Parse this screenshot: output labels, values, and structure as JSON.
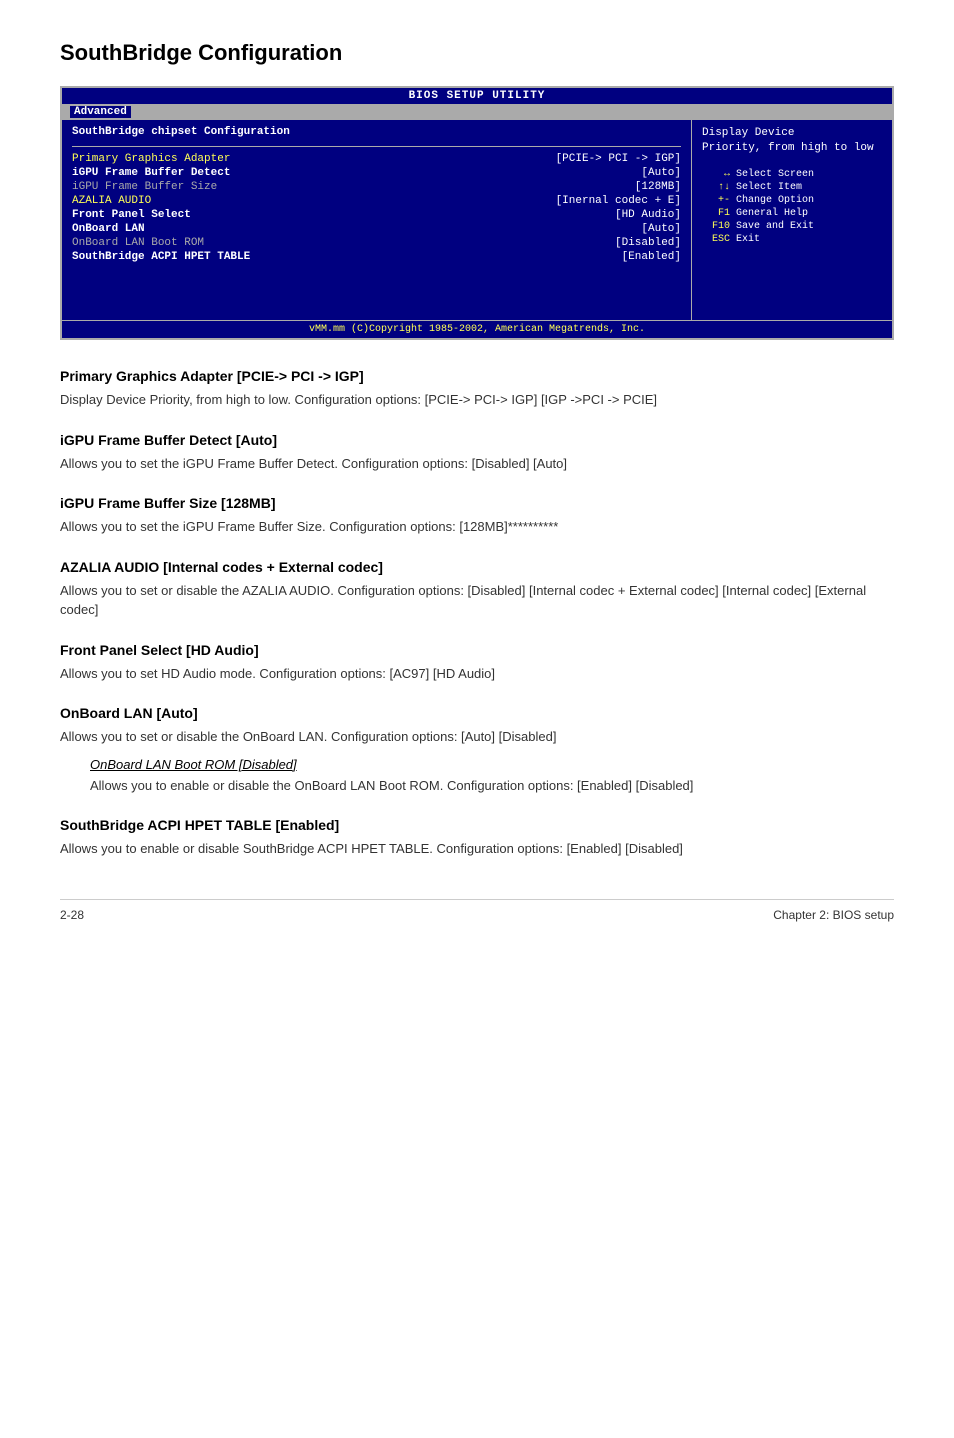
{
  "page": {
    "title": "SouthBridge Configuration",
    "footer_left": "2-28",
    "footer_right": "Chapter 2: BIOS setup"
  },
  "bios": {
    "top_bar": "BIOS SETUP UTILITY",
    "menu_active": "Advanced",
    "section_title": "SouthBridge chipset Configuration",
    "rows": [
      {
        "label": "Primary Graphics Adapter",
        "label_class": "yellow",
        "value": "[PCIE-> PCI -> IGP]"
      },
      {
        "label": "iGPU Frame Buffer Detect",
        "label_class": "highlight",
        "value": "[Auto]"
      },
      {
        "label": "iGPU Frame Buffer Size",
        "label_class": "normal",
        "value": "[128MB]"
      },
      {
        "label": "AZALIA AUDIO",
        "label_class": "yellow",
        "value": "[Inernal codec + E]"
      },
      {
        "label": "Front Panel Select",
        "label_class": "highlight",
        "value": "[HD Audio]"
      },
      {
        "label": "OnBoard LAN",
        "label_class": "highlight",
        "value": "[Auto]"
      },
      {
        "label": " OnBoard LAN Boot ROM",
        "label_class": "normal",
        "value": "[Disabled]"
      },
      {
        "label": "SouthBridge ACPI HPET TABLE",
        "label_class": "highlight",
        "value": "[Enabled]"
      }
    ],
    "help_title": "Display Device",
    "help_text": "Priority, from high to low",
    "keys": [
      {
        "key": "↔",
        "desc": "Select Screen"
      },
      {
        "key": "↑↓",
        "desc": "Select Item"
      },
      {
        "key": "+-",
        "desc": "Change Option"
      },
      {
        "key": "F1",
        "desc": "General Help"
      },
      {
        "key": "F10",
        "desc": "Save and Exit"
      },
      {
        "key": "ESC",
        "desc": "Exit"
      }
    ],
    "footer": "vMM.mm (C)Copyright 1985-2002, American Megatrends, Inc."
  },
  "sections": [
    {
      "id": "primary-graphics",
      "heading": "Primary Graphics Adapter [PCIE-> PCI -> IGP]",
      "body": "Display Device Priority, from high to low. Configuration options: [PCIE-> PCI-> IGP] [IGP ->PCI -> PCIE]",
      "sub": null
    },
    {
      "id": "igpu-detect",
      "heading": "iGPU Frame Buffer Detect [Auto]",
      "body": "Allows you to set the iGPU Frame Buffer Detect. Configuration options: [Disabled] [Auto]",
      "sub": null
    },
    {
      "id": "igpu-size",
      "heading": "iGPU Frame Buffer Size [128MB]",
      "body": "Allows you to set the iGPU Frame Buffer Size. Configuration options: [128MB]**********",
      "sub": null
    },
    {
      "id": "azalia",
      "heading": "AZALIA AUDIO [Internal codes + External codec]",
      "body": "Allows you to set or disable the AZALIA AUDIO. Configuration options: [Disabled] [Internal codec + External codec] [Internal codec] [External codec]",
      "sub": null
    },
    {
      "id": "front-panel",
      "heading": "Front Panel Select [HD Audio]",
      "body": "Allows you to set HD Audio mode. Configuration options: [AC97] [HD Audio]",
      "sub": null
    },
    {
      "id": "onboard-lan",
      "heading": "OnBoard LAN [Auto]",
      "body": "Allows you to set or disable the OnBoard LAN. Configuration options: [Auto] [Disabled]",
      "sub": {
        "heading": "OnBoard LAN Boot ROM [Disabled]",
        "body": "Allows you to enable or disable the OnBoard LAN Boot ROM. Configuration options: [Enabled] [Disabled]"
      }
    },
    {
      "id": "southbridge-acpi",
      "heading": "SouthBridge ACPI HPET TABLE [Enabled]",
      "body": "Allows you to enable or disable SouthBridge ACPI HPET TABLE. Configuration options: [Enabled] [Disabled]",
      "sub": null
    }
  ]
}
